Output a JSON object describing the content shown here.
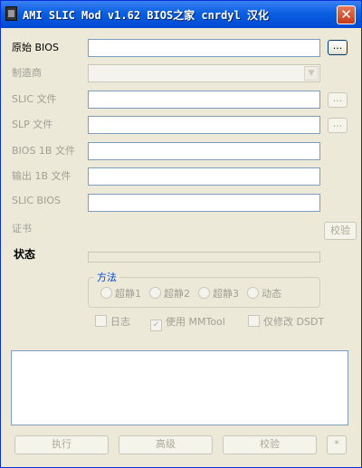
{
  "window": {
    "title": "AMI SLIC Mod v1.62  BIOS之家 cnrdyl 汉化",
    "close_glyph": "✕"
  },
  "form": {
    "original_bios_label": "原始 BIOS",
    "original_bios_value": "",
    "manufacturer_label": "制造商",
    "manufacturer_value": "",
    "slic_file_label": "SLIC 文件",
    "slic_file_value": "",
    "slp_file_label": "SLP 文件",
    "slp_file_value": "",
    "bios1b_file_label": "BIOS 1B 文件",
    "bios1b_file_value": "",
    "output1b_file_label": "输出 1B 文件",
    "output1b_file_value": "",
    "slic_bios_label": "SLIC BIOS",
    "slic_bios_value": "",
    "certificate_label": "证书",
    "browse_label": "...",
    "verify_small_label": "校验"
  },
  "status": {
    "label": "状态"
  },
  "method": {
    "title": "方法",
    "options": [
      "超静1",
      "超静2",
      "超静3",
      "动态"
    ]
  },
  "options": {
    "log_label": "日志",
    "mmtool_label": "使用 MMTool",
    "mmtool_checked": true,
    "dsdt_label": "仅修改 DSDT"
  },
  "actions": {
    "run_label": "执行",
    "advanced_label": "高级",
    "verify_label": "校验",
    "star_label": "*"
  },
  "colors": {
    "titlebar": "#0a5fe0",
    "dialog_bg": "#ece9d8",
    "input_border": "#7f9db9",
    "disabled_text": "#a19f95",
    "group_title": "#0046d5"
  },
  "icons": {
    "app": "chip-icon",
    "close": "close-icon",
    "dropdown": "chevron-down-icon"
  }
}
